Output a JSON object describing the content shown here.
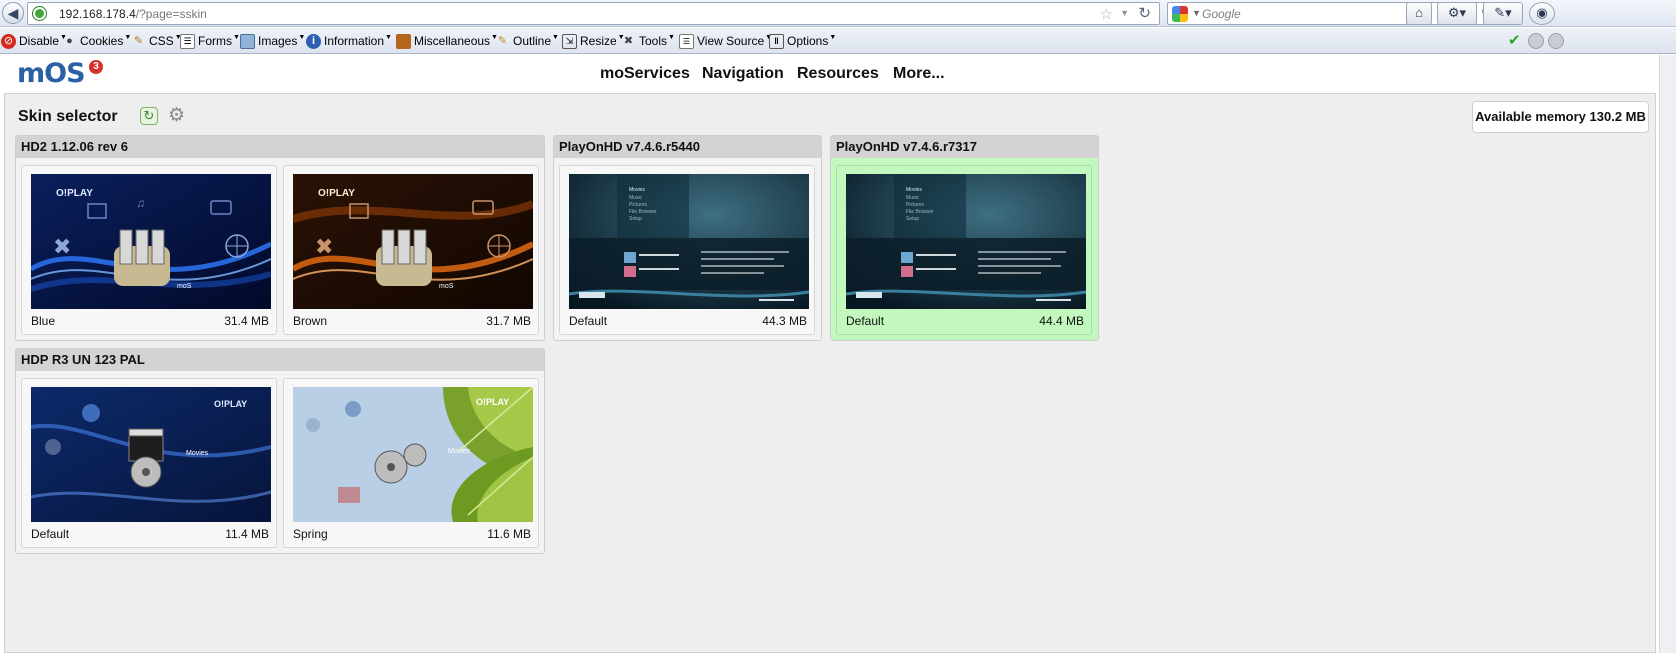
{
  "browser": {
    "url_host": "192.168.178.4",
    "url_path": "/?page=sskin",
    "search_placeholder": "Google"
  },
  "webdev_toolbar": [
    {
      "label": "Disable",
      "icon": "disable-icon"
    },
    {
      "label": "Cookies",
      "icon": "cookies-icon"
    },
    {
      "label": "CSS",
      "icon": "css-icon"
    },
    {
      "label": "Forms",
      "icon": "forms-icon"
    },
    {
      "label": "Images",
      "icon": "images-icon"
    },
    {
      "label": "Information",
      "icon": "information-icon"
    },
    {
      "label": "Miscellaneous",
      "icon": "miscellaneous-icon"
    },
    {
      "label": "Outline",
      "icon": "outline-icon"
    },
    {
      "label": "Resize",
      "icon": "resize-icon"
    },
    {
      "label": "Tools",
      "icon": "tools-icon"
    },
    {
      "label": "View Source",
      "icon": "view-source-icon"
    },
    {
      "label": "Options",
      "icon": "options-icon"
    }
  ],
  "site": {
    "logo": "mOS",
    "logo_badge": "3",
    "nav": [
      "moServices",
      "Navigation",
      "Resources",
      "More..."
    ]
  },
  "page": {
    "title": "Skin selector",
    "memory_label": "Available memory 130.2 MB"
  },
  "groups": [
    {
      "title": "HD2 1.12.06 rev 6",
      "skins": [
        {
          "name": "Blue",
          "size": "31.4 MB",
          "thumb_label": "moS"
        },
        {
          "name": "Brown",
          "size": "31.7 MB",
          "thumb_label": "moS"
        }
      ]
    },
    {
      "title": "PlayOnHD v7.4.6.r5440",
      "skins": [
        {
          "name": "Default",
          "size": "44.3 MB"
        }
      ]
    },
    {
      "title": "PlayOnHD v7.4.6.r7317",
      "skins": [
        {
          "name": "Default",
          "size": "44.4 MB"
        }
      ]
    },
    {
      "title": "HDP R3 UN 123 PAL",
      "skins": [
        {
          "name": "Default",
          "size": "11.4 MB",
          "thumb_label": "Movies"
        },
        {
          "name": "Spring",
          "size": "11.6 MB",
          "thumb_label": "Movies"
        }
      ]
    }
  ],
  "thumb_text": {
    "oplay_logo": "O!PLAY",
    "playon_menu": [
      "Movies",
      "Music",
      "Pictures",
      "File Browser",
      "Setup"
    ]
  },
  "colors": {
    "selected_skin_bg": "#c2f7bd",
    "group_header_bg": "#d3d3d3",
    "logo_blue": "#2b5fa6"
  }
}
